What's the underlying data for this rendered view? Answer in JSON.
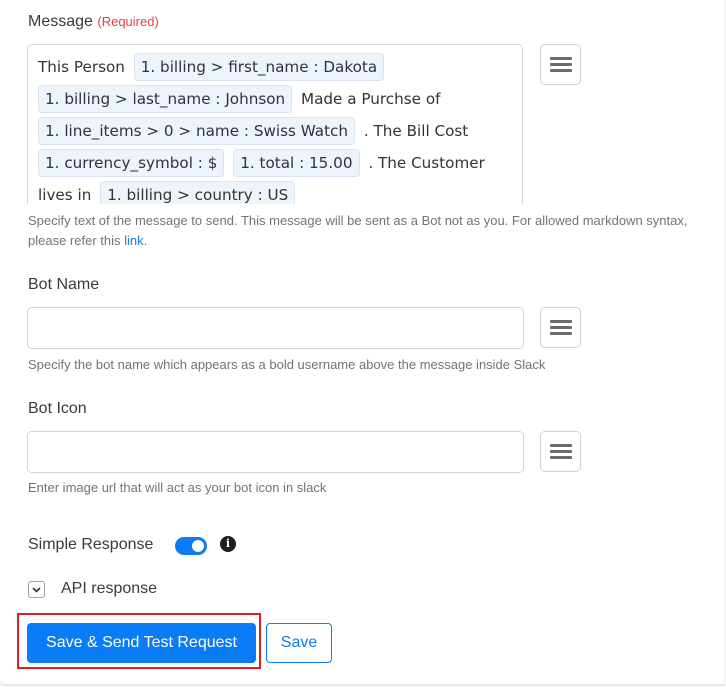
{
  "message_field": {
    "label": "Message",
    "required_label": "(Required)",
    "segments": [
      {
        "type": "text",
        "value": "This Person"
      },
      {
        "type": "pill",
        "value": "1. billing > first_name : Dakota"
      },
      {
        "type": "pill",
        "value": "1. billing > last_name : Johnson"
      },
      {
        "type": "text",
        "value": "Made a Purchse of"
      },
      {
        "type": "pill",
        "value": "1. line_items > 0 > name : Swiss Watch"
      },
      {
        "type": "text",
        "value": ". The Bill Cost"
      },
      {
        "type": "pill",
        "value": "1. currency_symbol : $"
      },
      {
        "type": "pill",
        "value": "1. total : 15.00"
      },
      {
        "type": "text",
        "value": ". The Customer lives in"
      },
      {
        "type": "pill",
        "value": "1. billing > country : US"
      }
    ],
    "help_text": "Specify text of the message to send. This message will be sent as a Bot not as you. For allowed markdown syntax, please refer this",
    "help_link": "link",
    "help_suffix": "."
  },
  "bot_name_field": {
    "label": "Bot Name",
    "value": "",
    "help_text": "Specify the bot name which appears as a bold username above the message inside Slack"
  },
  "bot_icon_field": {
    "label": "Bot Icon",
    "value": "",
    "help_text": "Enter image url that will act as your bot icon in slack"
  },
  "simple_response": {
    "label": "Simple Response",
    "enabled": true
  },
  "api_response": {
    "label": "API response"
  },
  "buttons": {
    "primary": "Save & Send Test Request",
    "secondary": "Save"
  },
  "colors": {
    "primary": "#0a7cf5",
    "required": "#e0404a",
    "highlight": "#e31b23"
  }
}
